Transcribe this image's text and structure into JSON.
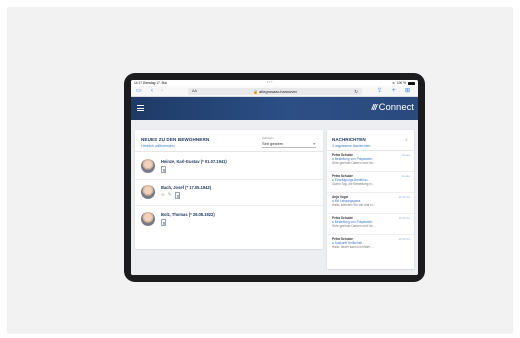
{
  "statusbar": {
    "time": "14:17",
    "date": "Dienstag 17. Mai",
    "dots": "•••",
    "battery": "100 %"
  },
  "browser": {
    "aa_label": "AA",
    "url": "allegrosaar-hannover",
    "reload_icon": "reload-icon"
  },
  "app": {
    "logo_mark": "///",
    "logo_text": "Connect"
  },
  "news": {
    "title": "NEUES ZU DEN BEWOHNERN",
    "subtitle": "Herzlich willkommen!",
    "since_label": "Zeitraum",
    "since_value": "Seit gestern",
    "residents": [
      {
        "name": "Heinze, Karl-Gustav (* 01.07.1941)"
      },
      {
        "name": "Bach, Josef (* 17.05.1943)"
      },
      {
        "name": "Bolz, Thomas (* 29.08.1922)"
      }
    ]
  },
  "messages": {
    "title": "NACHRICHTEN",
    "close": "✕",
    "subtitle": "4 ungelesene Nachrichten",
    "items": [
      {
        "sender": "Petra Schulze",
        "date": "Heute",
        "subject": "● Bestellung von Präparaten",
        "preview": "Sehr geehrte Damen und He..."
      },
      {
        "sender": "Petra Schulze",
        "date": "Heute",
        "subject": "● Einwilligungs-Bestellun...",
        "preview": "Guten Tag, die Bestellung in..."
      },
      {
        "sender": "Anja Vogel",
        "date": "11.05.22",
        "subject": "● Mit Leistungspass",
        "preview": "Hallo, könnten Sie mir mal ei..."
      },
      {
        "sender": "Petra Schulze",
        "date": "11.05.22",
        "subject": "● Bestellung von Präparaten",
        "preview": "Sehr geehrte Damen und He..."
      },
      {
        "sender": "Petra Schulze",
        "date": "10.05.22",
        "subject": "● Auskunft Heilbehelf",
        "preview": "Hallo, leider kann ich leider ..."
      }
    ]
  },
  "colors": {
    "header_blue": "#2c4f86",
    "accent_blue": "#3a78c3",
    "title_navy": "#1f3a66"
  }
}
